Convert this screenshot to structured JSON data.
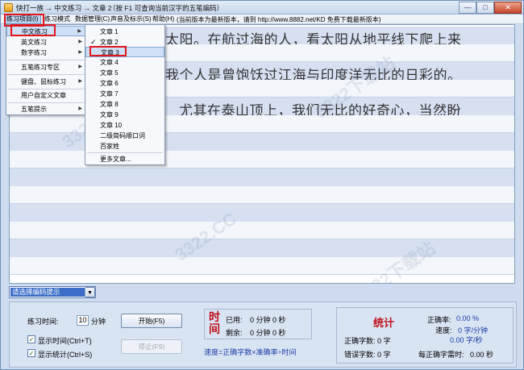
{
  "titlebar": {
    "title": "快打一族 → 中文练习 → 文章 2",
    "hint": "（按 F1 可查询当前汉字的五笔编码）",
    "minimize": "—",
    "maximize": "□",
    "close": "✕"
  },
  "menubar": {
    "items": [
      {
        "label": "练习项目(I)"
      },
      {
        "label": "练习模式"
      },
      {
        "label": "数据管理(C)"
      },
      {
        "label": "声音及标示(S)"
      },
      {
        "label": "帮助(H)"
      }
    ],
    "notice": "(当前版本为最新版本，请到 http://www.8882.net/KD 免费下载最新版本)"
  },
  "text_lines": [
    "太阳。在航过海的人，看太阳从地平线下爬上来",
    "我个人是曾饱饫过江海与印度洋无比的日彩的。",
    "尤其在泰山顶上，我们无比的好奇心，当然盼"
  ],
  "watermarks": [
    "3322下载站",
    "3322.CC",
    "3322下载站",
    "3322.CC"
  ],
  "menu1": {
    "items": [
      {
        "label": "中文练习",
        "submenu": true
      },
      {
        "label": "英文练习",
        "submenu": true
      },
      {
        "label": "数字练习",
        "submenu": true
      },
      {
        "label": "五笔练习专区",
        "submenu": true
      },
      {
        "label": "键盘、鼠标练习",
        "submenu": true
      },
      {
        "label": "用户自定义文章",
        "submenu": false
      },
      {
        "label": "五笔提示",
        "submenu": true
      }
    ],
    "arrow": "▶"
  },
  "menu2": {
    "items": [
      "文章 1",
      "文章 2",
      "文章 3",
      "文章 4",
      "文章 5",
      "文章 6",
      "文章 7",
      "文章 8",
      "文章 9",
      "文章 10",
      "二级简码顺口词",
      "百家姓",
      "更多文章..."
    ],
    "checked_index": 1,
    "check_mark": "✓"
  },
  "hint_select": {
    "value": "请选择编码提示",
    "arrow": "▼"
  },
  "controls": {
    "practice_time_label": "练习时间:",
    "practice_time_value": "10",
    "practice_time_unit": "分钟",
    "show_time_label": "显示时间(Ctrl+T)",
    "show_stats_label": "显示统计(Ctrl+S)",
    "checkmark": "✓",
    "start_button": "开始(F5)",
    "stop_button": "停止(F9)"
  },
  "time": {
    "title": "时间",
    "used_label": "已用:",
    "used_value": "0 分钟 0 秒",
    "remaining_label": "剩余:",
    "remaining_value": "0 分钟 0 秒",
    "formula": "速度=正确字数×准确率÷时间"
  },
  "stats": {
    "title": "统计",
    "correct_chars": "正确字数: 0 字",
    "wrong_chars": "错误字数: 0 字",
    "accuracy_label": "正确率:",
    "accuracy_value": "0.00 %",
    "speed_label": "速度:",
    "speed_value_1": "0 字/分钟",
    "speed_value_2": "0.00 字/秒",
    "per_char_time_label": "每正确字需时:",
    "per_char_time_value": "0.00 秒"
  }
}
